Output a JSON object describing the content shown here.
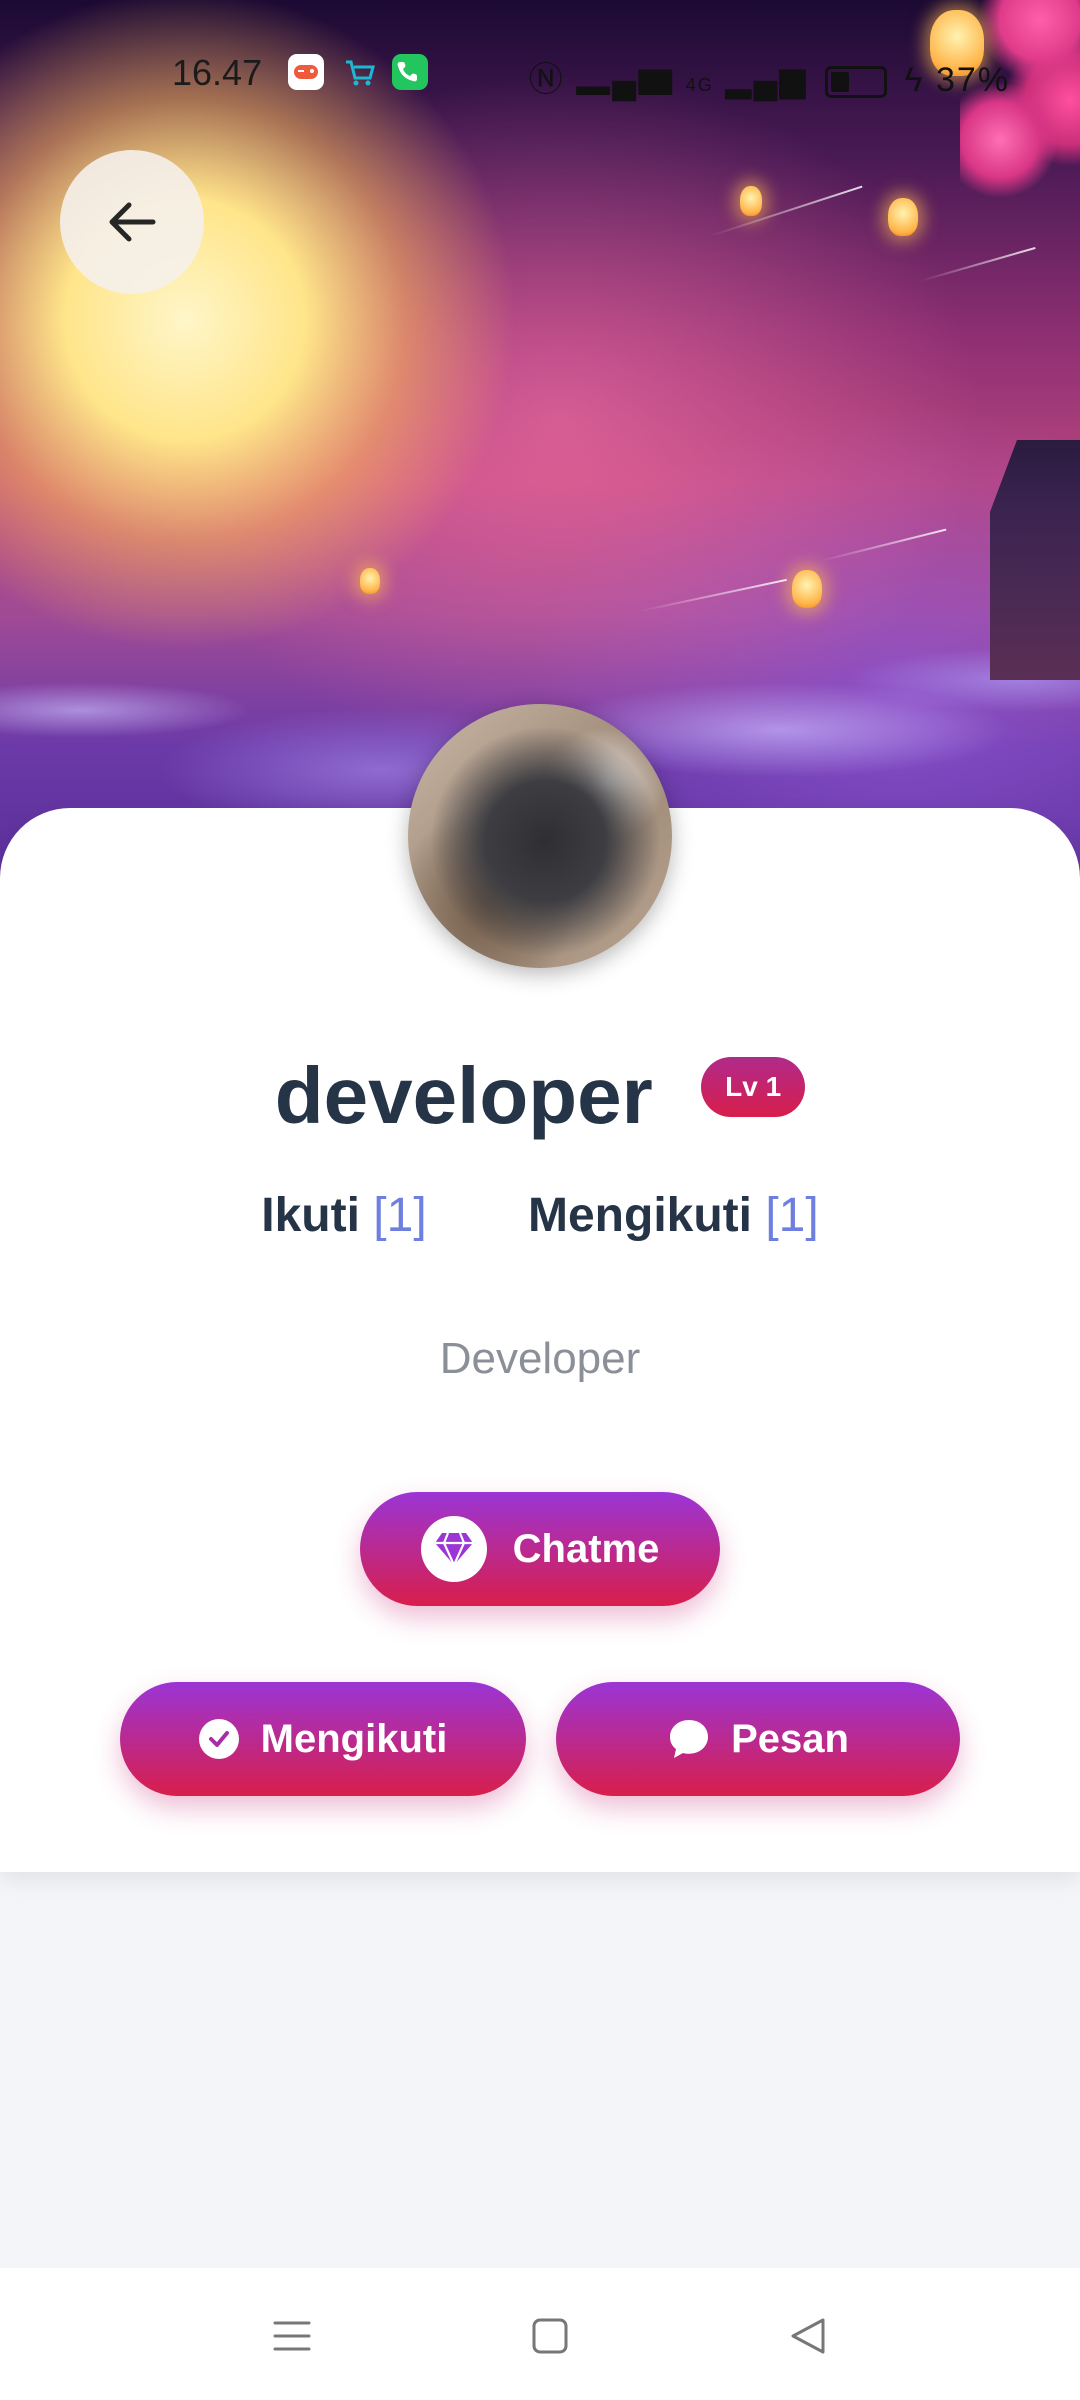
{
  "status_bar": {
    "time": "16.47",
    "right_text": "4G",
    "battery_pct": "37%",
    "app_icons": [
      "game-controller-icon",
      "shopping-cart-icon",
      "phone-icon"
    ],
    "indicator_icons": [
      "nfc-icon",
      "signal-icon",
      "signal-4g-icon",
      "battery-icon",
      "charging-icon"
    ]
  },
  "header": {
    "back_icon": "arrow-left-icon"
  },
  "profile": {
    "username": "developer",
    "level_badge": "Lv 1",
    "followers_label": "Ikuti",
    "followers_count": "[1]",
    "following_label": "Mengikuti",
    "following_count": "[1]",
    "bio": "Developer"
  },
  "actions": {
    "chatme_label": "Chatme",
    "chatme_icon": "diamond-icon",
    "follow_label": "Mengikuti",
    "follow_icon": "check-circle-icon",
    "message_label": "Pesan",
    "message_icon": "chat-bubble-icon"
  },
  "colors": {
    "button_gradient_top": "#9b35d6",
    "button_gradient_bottom": "#d81e4b",
    "count_accent": "#6f7fe0",
    "name_text": "#263447"
  },
  "nav_bar": {
    "icons": [
      "menu-icon",
      "home-square-icon",
      "back-triangle-icon"
    ]
  }
}
